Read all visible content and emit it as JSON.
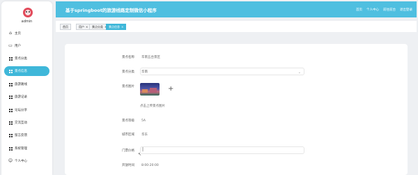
{
  "app": {
    "title": "基于springboot的旅游线路定制微信小程序",
    "header_links": [
      "首页",
      "个人中心",
      "前往前台",
      "退出登录"
    ]
  },
  "sidebar": {
    "username": "admin",
    "items": [
      {
        "label": "主页",
        "icon": "home-icon",
        "active": false
      },
      {
        "label": "用户",
        "icon": "user-icon",
        "active": false
      },
      {
        "label": "景点分类",
        "icon": "grid-icon",
        "active": false
      },
      {
        "label": "景点信息",
        "icon": "grid-icon",
        "active": true
      },
      {
        "label": "旅游路线",
        "icon": "grid-icon",
        "active": false
      },
      {
        "label": "旅游记录",
        "icon": "grid-icon",
        "active": false
      },
      {
        "label": "论坛分享",
        "icon": "grid-icon",
        "active": false
      },
      {
        "label": "交流互动",
        "icon": "grid-icon",
        "active": false
      },
      {
        "label": "留言反馈",
        "icon": "grid-icon",
        "active": false
      },
      {
        "label": "系统管理",
        "icon": "grid-icon",
        "active": false
      },
      {
        "label": "个人中心",
        "icon": "person-icon",
        "active": false
      }
    ]
  },
  "tabs": [
    {
      "label": "首页",
      "closable": false,
      "active": false
    },
    {
      "label": "用户",
      "closable": true,
      "active": false
    },
    {
      "label": "景点分类",
      "closable": true,
      "active": false
    },
    {
      "label": "景点信息",
      "closable": true,
      "active": true
    }
  ],
  "form": {
    "name_label": "景点名称",
    "name_value": "华南五台景区",
    "category_label": "景点分类",
    "category_value": "华南",
    "image_label": "景点图片",
    "upload_hint": "点击上传景点图片",
    "rating_label": "景点等级",
    "rating_value": "5A",
    "city_label": "城市区域",
    "city_value": "华东",
    "ticket_label": "门票价格",
    "ticket_value": "",
    "hours_label": "开放时间",
    "hours_value": "8:00-20:00"
  },
  "colors": {
    "accent": "#3fb7d9",
    "header": "#4fbfe0",
    "background": "#eef0f3"
  }
}
